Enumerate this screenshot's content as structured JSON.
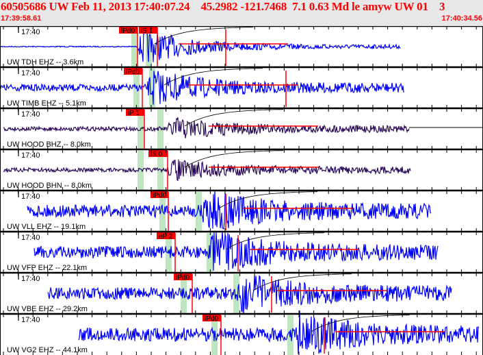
{
  "header": {
    "title": "60505686 UW Feb 11, 2013 17:40:07.24    45.2982 -121.7468  7.1 0.63 Md le amyw UW 01    3",
    "start_time": "17:39:58.61",
    "end_time": "17:40:34.56"
  },
  "colors": {
    "trace": "#0000ff",
    "trace_dark": "#2a0a5a",
    "pick": "#ff0000",
    "window": "#bfe6c0",
    "header_text": "#ff0000"
  },
  "tick_label": "17:40",
  "panels": [
    {
      "label": "UW TDH EHZ -- 3.6km",
      "picks": [
        "iPd0",
        "iS 1"
      ],
      "dark": false
    },
    {
      "label": "UW TIMB EHZ -- 5.1km",
      "picks": [
        "iPd0"
      ],
      "dark": false
    },
    {
      "label": "UW HOOD BHZ -- 8.0km",
      "picks": [
        "iP 1"
      ],
      "dark": true
    },
    {
      "label": "UW HOOD BHN -- 8.0km",
      "picks": [
        "iS 0"
      ],
      "dark": true
    },
    {
      "label": "UW VLL EHZ -- 19.1km",
      "picks": [
        "iPd0"
      ],
      "dark": false
    },
    {
      "label": "UW VFP EHZ -- 22.1km",
      "picks": [
        "eP 2"
      ],
      "dark": false
    },
    {
      "label": "UW VBE EHZ -- 29.2km",
      "picks": [
        "iPd0"
      ],
      "dark": false
    },
    {
      "label": "UW VG2 EHZ -- 44.1km",
      "picks": [
        "iPd0"
      ],
      "dark": false
    }
  ]
}
